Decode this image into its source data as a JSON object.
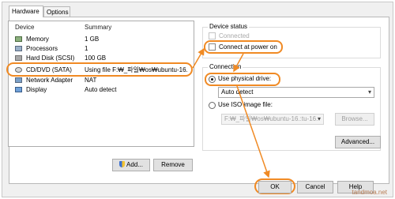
{
  "tabs": [
    {
      "label": "Hardware"
    },
    {
      "label": "Options"
    }
  ],
  "hardware_list": {
    "columns": [
      "Device",
      "Summary"
    ],
    "rows": [
      {
        "icon": "memory-icon",
        "device": "Memory",
        "summary": "1 GB"
      },
      {
        "icon": "processor-icon",
        "device": "Processors",
        "summary": "1"
      },
      {
        "icon": "hard-disk-icon",
        "device": "Hard Disk (SCSI)",
        "summary": "100 GB"
      },
      {
        "icon": "cd-dvd-icon",
        "device": "CD/DVD (SATA)",
        "summary": "Using file F:₩_파일₩os₩ubuntu-16."
      },
      {
        "icon": "network-adapter-icon",
        "device": "Network Adapter",
        "summary": "NAT"
      },
      {
        "icon": "display-icon",
        "device": "Display",
        "summary": "Auto detect"
      }
    ]
  },
  "buttons": {
    "add": "Add...",
    "remove": "Remove",
    "advanced": "Advanced...",
    "browse": "Browse...",
    "ok": "OK",
    "cancel": "Cancel",
    "help": "Help"
  },
  "device_status": {
    "title": "Device status",
    "connected": "Connected",
    "connect_at_power_on": "Connect at power on"
  },
  "connection": {
    "title": "Connection",
    "use_physical_drive": "Use physical drive:",
    "physical_drive_value": "Auto detect",
    "use_iso_image": "Use ISO image file:",
    "iso_path": "F:₩_파일₩os₩ubuntu-16.:tu-16."
  },
  "watermark": "tandmoa.net",
  "colors": {
    "highlight": "#f08a24"
  }
}
